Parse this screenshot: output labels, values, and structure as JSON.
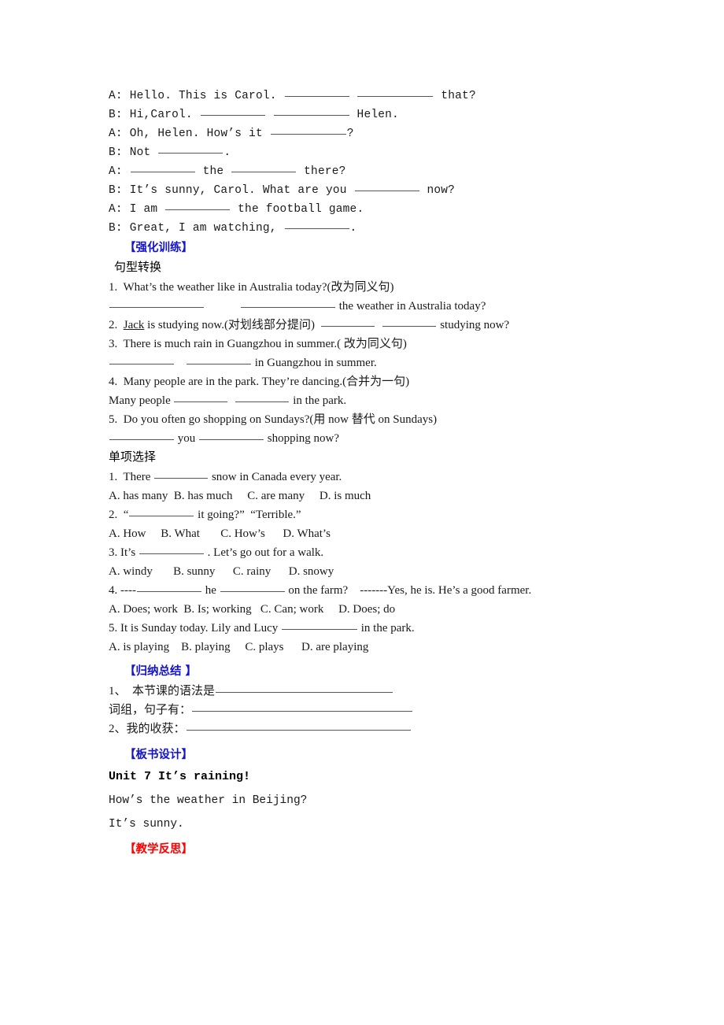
{
  "document": {
    "type": "worksheet",
    "unit_title": "Unit 7 It’s raining!",
    "colors": {
      "heading_blue": "#1414cc",
      "heading_red": "#ff0000",
      "body_text": "#1a1a1a",
      "blank_rule": "#555555",
      "background": "#ffffff"
    }
  },
  "dialogue": {
    "lines": [
      {
        "speaker": "A:",
        "before": " Hello. This is Carol. ",
        "mid": " ",
        "after": " that?",
        "blanks": [
          82,
          96
        ]
      },
      {
        "speaker": "B:",
        "before": " Hi,Carol. ",
        "mid": " ",
        "after": " Helen.",
        "blanks": [
          82,
          96
        ]
      },
      {
        "speaker": "A:",
        "before": " Oh, Helen. How’s it ",
        "mid": "",
        "after": "?",
        "blanks": [
          96
        ]
      },
      {
        "speaker": "B:",
        "before": " Not ",
        "mid": "",
        "after": ".",
        "blanks": [
          82
        ]
      },
      {
        "speaker": "A:",
        "before": " ",
        "mid": " the ",
        "after": " there?",
        "blanks": [
          82,
          82
        ]
      },
      {
        "speaker": "B:",
        "before": " It’s sunny, Carol. What are you ",
        "mid": "",
        "after": " now?",
        "blanks": [
          82
        ]
      },
      {
        "speaker": "A:",
        "before": " I am ",
        "mid": "",
        "after": " the football game.",
        "blanks": [
          82
        ]
      },
      {
        "speaker": "B:",
        "before": " Great, I am watching, ",
        "mid": "",
        "after": ".",
        "blanks": [
          82
        ]
      }
    ]
  },
  "sections": {
    "drill": {
      "label": "【强化训练】",
      "color": "blue"
    },
    "summary": {
      "label": "【归纳总结 】",
      "color": "blue"
    },
    "board_design": {
      "label": "【板书设计】",
      "color": "blue"
    },
    "reflection": {
      "label": "【教学反思】",
      "color": "red"
    }
  },
  "sentence_transformation": {
    "heading": "句型转换",
    "items": [
      {
        "number": "1.",
        "prompt": "  What’s the weather like in Australia today?(改为同义句)",
        "answer_prefix": "",
        "answer_middle": "            ",
        "answer_suffix": " the weather in Australia today?"
      },
      {
        "number": "2.",
        "prompt_pre": "  ",
        "underlined": "Jack",
        "prompt_post": " is studying now.(对划线部分提问)  ",
        "answer_suffix": " studying now?"
      },
      {
        "number": "3.",
        "prompt": "  There is much rain in Guangzhou in summer.( 改为同义句)",
        "answer_suffix": " in Guangzhou in summer."
      },
      {
        "number": "4.",
        "prompt": "  Many people are in the park. They’re dancing.(合并为一句)",
        "answer_prefix": "Many people ",
        "answer_suffix": " in the park."
      },
      {
        "number": "5.",
        "prompt": "  Do you often go shopping on Sundays?(用 now 替代 on Sundays)",
        "answer_middle": " you ",
        "answer_suffix": " shopping now?"
      }
    ]
  },
  "multiple_choice": {
    "heading": "单项选择",
    "questions": [
      {
        "number": "1.",
        "stem_pre": "  There ",
        "stem_post": " snow in Canada every year.",
        "options": "A. has many  B. has much     C. are many     D. is much"
      },
      {
        "number": "2.",
        "stem_pre": "  “",
        "stem_post": " it going?”  “Terrible.”",
        "options": "A. How     B. What       C. How’s      D. What’s"
      },
      {
        "number": "3.",
        "stem_pre": " It’s ",
        "stem_post": " . Let’s go out for a walk.",
        "options": "A. windy       B. sunny      C. rainy      D. snowy"
      },
      {
        "number": "4.",
        "stem_pre": " ----",
        "stem_mid": " he ",
        "stem_post": " on the farm?    -------Yes, he is. He’s a good farmer.",
        "options": "A. Does; work  B. Is; working   C. Can; work     D. Does; do"
      },
      {
        "number": "5.",
        "stem_pre": " It is Sunday today. Lily and Lucy ",
        "stem_post": " in the park.",
        "options": "A. is playing    B. playing     C. plays      D. are playing"
      }
    ]
  },
  "summary_items": [
    {
      "label": "1、  本节课的语法是",
      "blank_width": 225
    },
    {
      "label": "词组，句子有：",
      "blank_width": 280
    },
    {
      "label": "2、我的收获：",
      "blank_width": 285
    }
  ],
  "board_design": {
    "title": "Unit 7 It’s raining!",
    "lines": [
      "How’s the weather in Beijing?",
      "It’s sunny."
    ]
  }
}
